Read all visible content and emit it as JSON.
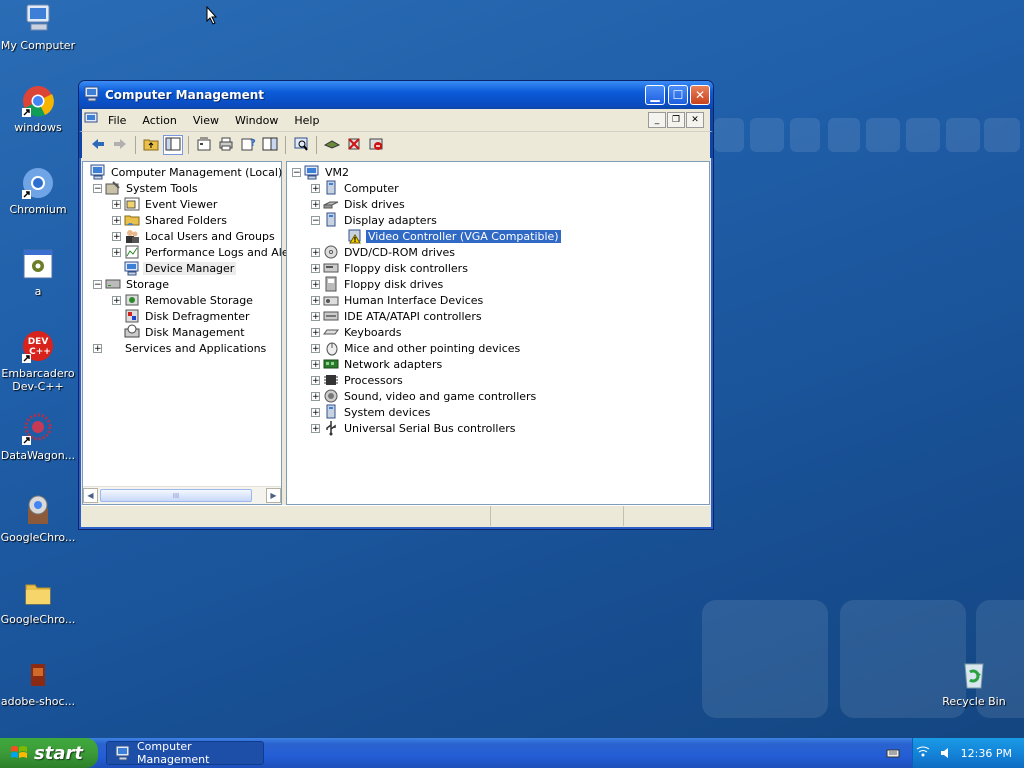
{
  "desktop": {
    "icons": [
      {
        "label": "My Computer",
        "icon": "my-computer-icon"
      },
      {
        "label": "windows",
        "icon": "chrome-shortcut-icon"
      },
      {
        "label": "Chromium",
        "icon": "chromium-shortcut-icon"
      },
      {
        "label": "a",
        "icon": "app-window-icon"
      },
      {
        "label": "Embarcadero Dev-C++",
        "icon": "devcpp-shortcut-icon"
      },
      {
        "label": "DataWagon...",
        "icon": "datawagon-shortcut-icon"
      },
      {
        "label": "GoogleChro...",
        "icon": "installer-icon"
      },
      {
        "label": "GoogleChro...",
        "icon": "folder-icon"
      },
      {
        "label": "adobe-shoc...",
        "icon": "shockwave-icon"
      },
      {
        "label": "Recycle Bin",
        "icon": "recycle-bin-icon"
      }
    ]
  },
  "window": {
    "title": "Computer Management",
    "menu": [
      "File",
      "Action",
      "View",
      "Window",
      "Help"
    ],
    "left_tree": [
      {
        "label": "Computer Management (Local)",
        "level": 0,
        "expander": ""
      },
      {
        "label": "System Tools",
        "level": 1,
        "expander": "−"
      },
      {
        "label": "Event Viewer",
        "level": 2,
        "expander": "+"
      },
      {
        "label": "Shared Folders",
        "level": 2,
        "expander": "+"
      },
      {
        "label": "Local Users and Groups",
        "level": 2,
        "expander": "+"
      },
      {
        "label": "Performance Logs and Alerts",
        "level": 2,
        "expander": "+"
      },
      {
        "label": "Device Manager",
        "level": 2,
        "expander": ""
      },
      {
        "label": "Storage",
        "level": 1,
        "expander": "−"
      },
      {
        "label": "Removable Storage",
        "level": 2,
        "expander": "+"
      },
      {
        "label": "Disk Defragmenter",
        "level": 2,
        "expander": ""
      },
      {
        "label": "Disk Management",
        "level": 2,
        "expander": ""
      },
      {
        "label": "Services and Applications",
        "level": 1,
        "expander": "+"
      }
    ],
    "right_tree": [
      {
        "label": "VM2",
        "level": 0,
        "expander": "−"
      },
      {
        "label": "Computer",
        "level": 1,
        "expander": "+"
      },
      {
        "label": "Disk drives",
        "level": 1,
        "expander": "+"
      },
      {
        "label": "Display adapters",
        "level": 1,
        "expander": "−"
      },
      {
        "label": "Video Controller (VGA Compatible)",
        "level": 2,
        "expander": ""
      },
      {
        "label": "DVD/CD-ROM drives",
        "level": 1,
        "expander": "+"
      },
      {
        "label": "Floppy disk controllers",
        "level": 1,
        "expander": "+"
      },
      {
        "label": "Floppy disk drives",
        "level": 1,
        "expander": "+"
      },
      {
        "label": "Human Interface Devices",
        "level": 1,
        "expander": "+"
      },
      {
        "label": "IDE ATA/ATAPI controllers",
        "level": 1,
        "expander": "+"
      },
      {
        "label": "Keyboards",
        "level": 1,
        "expander": "+"
      },
      {
        "label": "Mice and other pointing devices",
        "level": 1,
        "expander": "+"
      },
      {
        "label": "Network adapters",
        "level": 1,
        "expander": "+"
      },
      {
        "label": "Processors",
        "level": 1,
        "expander": "+"
      },
      {
        "label": "Sound, video and game controllers",
        "level": 1,
        "expander": "+"
      },
      {
        "label": "System devices",
        "level": 1,
        "expander": "+"
      },
      {
        "label": "Universal Serial Bus controllers",
        "level": 1,
        "expander": "+"
      }
    ]
  },
  "taskbar": {
    "start_label": "start",
    "task_label": "Computer Management",
    "clock": "12:36 PM"
  }
}
